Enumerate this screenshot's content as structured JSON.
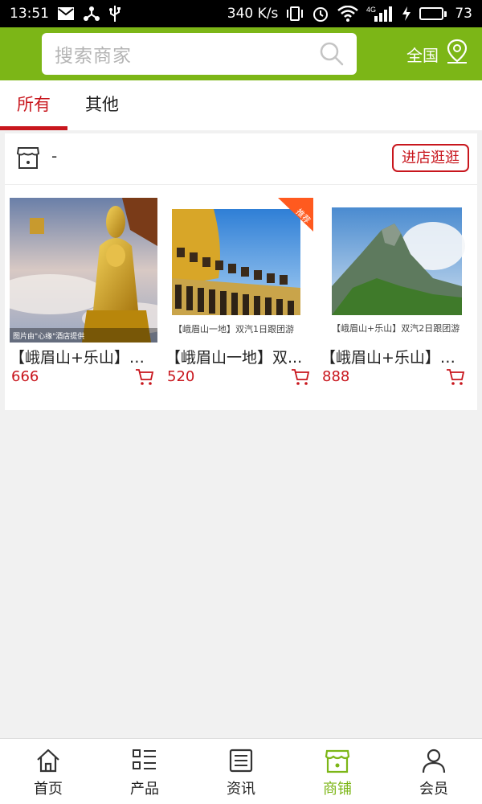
{
  "status_bar": {
    "time": "13:51",
    "speed": "340 K/s",
    "network": "4G",
    "battery": "73",
    "battery_level": 0.73
  },
  "header": {
    "search_placeholder": "搜索商家",
    "region": "全国"
  },
  "tabs": [
    {
      "label": "所有",
      "active": true
    },
    {
      "label": "其他",
      "active": false
    }
  ],
  "shop": {
    "name": "-",
    "visit_button": "进店逛逛",
    "products": [
      {
        "title": "【峨眉山+乐山】双...",
        "price": "666",
        "image_caption": "图片由\"心缘\"酒店提供"
      },
      {
        "title": "【峨眉山一地】双...",
        "price": "520",
        "badge": "推荐",
        "image_caption": "【峨眉山一地】双汽1日跟团游"
      },
      {
        "title": "【峨眉山+乐山】双...",
        "price": "888",
        "image_caption": "【峨眉山+乐山】双汽2日跟团游"
      }
    ]
  },
  "tabbar": {
    "items": [
      {
        "label": "首页",
        "icon": "home-icon"
      },
      {
        "label": "产品",
        "icon": "list-icon"
      },
      {
        "label": "资讯",
        "icon": "news-icon"
      },
      {
        "label": "商铺",
        "icon": "store-icon",
        "active": true
      },
      {
        "label": "会员",
        "icon": "user-icon"
      }
    ]
  },
  "colors": {
    "brand_green": "#7cb617",
    "accent_red": "#c8161d",
    "background": "#f1f1f1"
  }
}
